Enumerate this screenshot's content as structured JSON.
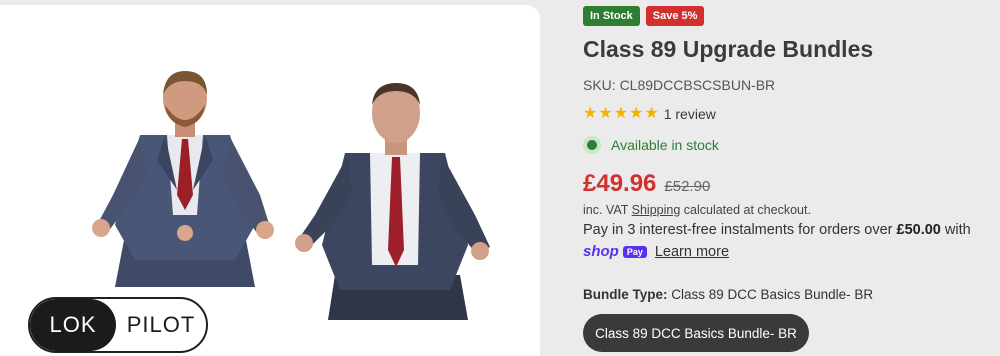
{
  "badges": {
    "in_stock": "In Stock",
    "save": "Save 5%"
  },
  "product": {
    "title": "Class 89 Upgrade Bundles",
    "sku": "SKU: CL89DCCBSCSBUN-BR",
    "rating": 5,
    "review_count": "1 review",
    "availability": "Available in stock",
    "price": "£49.96",
    "compare_price": "£52.90",
    "vat_prefix": "inc. VAT ",
    "vat_link": "Shipping",
    "vat_suffix": " calculated at checkout.",
    "instalments_prefix": "Pay in 3 interest-free instalments for orders over ",
    "instalments_amount": "£50.00",
    "instalments_suffix": " with",
    "shop_word": "shop",
    "pay_word": "Pay",
    "learn_more": "Learn more",
    "bundle_label": "Bundle Type:",
    "bundle_value": "Class 89 DCC Basics Bundle- BR",
    "bundle_option": "Class 89 DCC Basics Bundle- BR"
  },
  "logo": {
    "left": "LOK",
    "right": "PILOT"
  },
  "colors": {
    "accent_red": "#d0312d",
    "stock_green": "#2e7d32",
    "shop_pay_purple": "#5a31f4"
  }
}
